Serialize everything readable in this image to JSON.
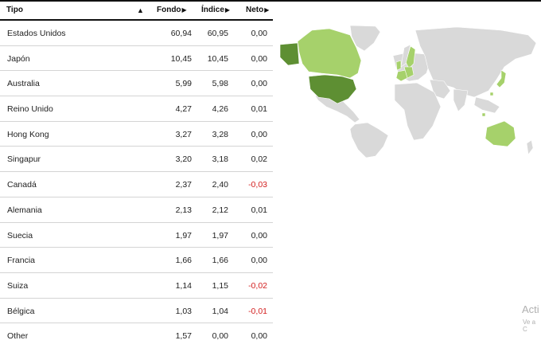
{
  "table": {
    "headers": {
      "tipo": "Tipo",
      "sort_icon": "▲",
      "fondo": "Fondo",
      "indice": "Índice",
      "neto": "Neto",
      "col_arrow": "▶"
    },
    "rows": [
      {
        "name": "Estados Unidos",
        "fondo": "60,94",
        "indice": "60,95",
        "neto": "0,00"
      },
      {
        "name": "Japón",
        "fondo": "10,45",
        "indice": "10,45",
        "neto": "0,00"
      },
      {
        "name": "Australia",
        "fondo": "5,99",
        "indice": "5,98",
        "neto": "0,00"
      },
      {
        "name": "Reino Unido",
        "fondo": "4,27",
        "indice": "4,26",
        "neto": "0,01"
      },
      {
        "name": "Hong Kong",
        "fondo": "3,27",
        "indice": "3,28",
        "neto": "0,00"
      },
      {
        "name": "Singapur",
        "fondo": "3,20",
        "indice": "3,18",
        "neto": "0,02"
      },
      {
        "name": "Canadá",
        "fondo": "2,37",
        "indice": "2,40",
        "neto": "-0,03"
      },
      {
        "name": "Alemania",
        "fondo": "2,13",
        "indice": "2,12",
        "neto": "0,01"
      },
      {
        "name": "Suecia",
        "fondo": "1,97",
        "indice": "1,97",
        "neto": "0,00"
      },
      {
        "name": "Francia",
        "fondo": "1,66",
        "indice": "1,66",
        "neto": "0,00"
      },
      {
        "name": "Suiza",
        "fondo": "1,14",
        "indice": "1,15",
        "neto": "-0,02"
      },
      {
        "name": "Bélgica",
        "fondo": "1,03",
        "indice": "1,04",
        "neto": "-0,01"
      },
      {
        "name": "Other",
        "fondo": "1,57",
        "indice": "0,00",
        "neto": "0,00"
      }
    ]
  },
  "colors": {
    "negative": "#d32020",
    "map_base": "#d9d9d9",
    "map_light": "#a6d16b",
    "map_dark": "#5e8f33"
  },
  "watermark": {
    "line1": "Acti",
    "line2": "Ve a C"
  }
}
